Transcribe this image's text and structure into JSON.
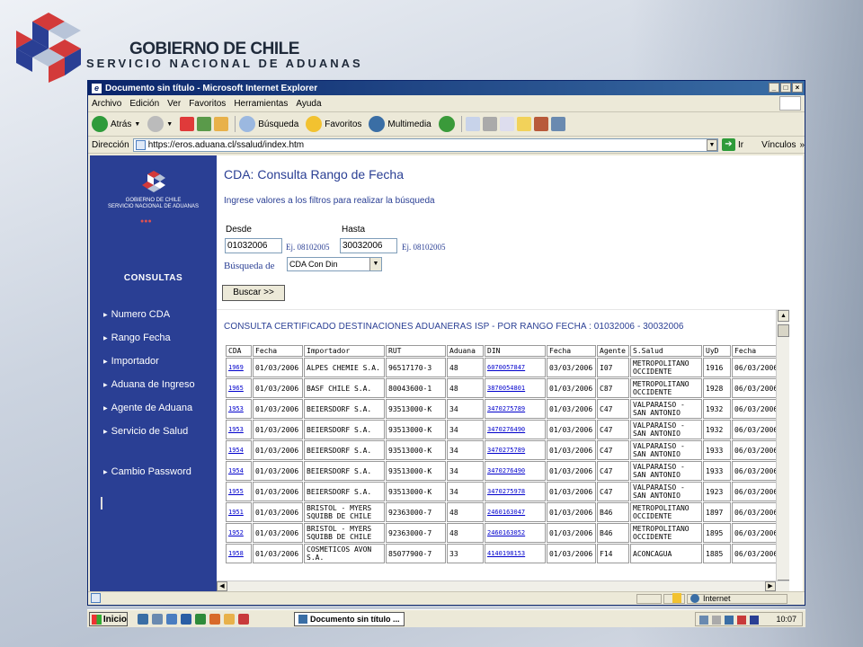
{
  "slide": {
    "header_title": "GOBIERNO DE CHILE",
    "header_subtitle": "SERVICIO NACIONAL DE ADUANAS"
  },
  "browser": {
    "title": "Documento sin título - Microsoft Internet Explorer",
    "menu": [
      "Archivo",
      "Edición",
      "Ver",
      "Favoritos",
      "Herramientas",
      "Ayuda"
    ],
    "toolbar": {
      "back": "Atrás",
      "search": "Búsqueda",
      "favorites": "Favoritos",
      "multimedia": "Multimedia"
    },
    "address_label": "Dirección",
    "url": "https://eros.aduana.cl/ssalud/index.htm",
    "go_label": "Ir",
    "links_label": "Vínculos",
    "status_zone": "Internet"
  },
  "sidebar": {
    "brand_line1": "GOBIERNO DE CHILE",
    "brand_line2": "SERVICIO NACIONAL DE ADUANAS",
    "section": "CONSULTAS",
    "items": [
      "Numero CDA",
      "Rango Fecha",
      "Importador",
      "Aduana de Ingreso",
      "Agente de Aduana",
      "Servicio de Salud",
      "Cambio Password"
    ]
  },
  "page": {
    "title": "CDA: Consulta Rango de Fecha",
    "intro": "Ingrese valores a los filtros para realizar la búsqueda",
    "desde_label": "Desde",
    "hasta_label": "Hasta",
    "desde_value": "01032006",
    "hasta_value": "30032006",
    "example_hint": "Ej. 08102005",
    "busqueda_label": "Búsqueda de",
    "busqueda_value": "CDA Con Din",
    "search_button": "Buscar >>",
    "result_title": "CONSULTA CERTIFICADO DESTINACIONES ADUANERAS ISP - POR RANGO FECHA : 01032006 - 30032006"
  },
  "table": {
    "headers": [
      "CDA",
      "Fecha",
      "Importador",
      "RUT",
      "Aduana",
      "DIN",
      "Fecha",
      "Agente",
      "S.Salud",
      "UyD",
      "Fecha"
    ],
    "rows": [
      [
        "1969",
        "01/03/2006",
        "ALPES CHEMIE S.A.",
        "96517170-3",
        "48",
        "6070057847",
        "03/03/2006",
        "I07",
        "METROPOLITANO OCCIDENTE",
        "1916",
        "06/03/2006"
      ],
      [
        "1965",
        "01/03/2006",
        "BASF CHILE S.A.",
        "80043600-1",
        "48",
        "3870054801",
        "01/03/2006",
        "C87",
        "METROPOLITANO OCCIDENTE",
        "1928",
        "06/03/2006"
      ],
      [
        "1953",
        "01/03/2006",
        "BEIERSDORF S.A.",
        "93513000-K",
        "34",
        "3470275789",
        "01/03/2006",
        "C47",
        "VALPARAISO - SAN ANTONIO",
        "1932",
        "06/03/2006"
      ],
      [
        "1953",
        "01/03/2006",
        "BEIERSDORF S.A.",
        "93513000-K",
        "34",
        "3470276490",
        "01/03/2006",
        "C47",
        "VALPARAISO - SAN ANTONIO",
        "1932",
        "06/03/2006"
      ],
      [
        "1954",
        "01/03/2006",
        "BEIERSDORF S.A.",
        "93513000-K",
        "34",
        "3470275789",
        "01/03/2006",
        "C47",
        "VALPARAISO - SAN ANTONIO",
        "1933",
        "06/03/2006"
      ],
      [
        "1954",
        "01/03/2006",
        "BEIERSDORF S.A.",
        "93513000-K",
        "34",
        "3470276490",
        "01/03/2006",
        "C47",
        "VALPARAISO - SAN ANTONIO",
        "1933",
        "06/03/2006"
      ],
      [
        "1955",
        "01/03/2006",
        "BEIERSDORF S.A.",
        "93513000-K",
        "34",
        "3470275978",
        "01/03/2006",
        "C47",
        "VALPARAISO - SAN ANTONIO",
        "1923",
        "06/03/2006"
      ],
      [
        "1951",
        "01/03/2006",
        "BRISTOL - MYERS SQUIBB DE CHILE",
        "92363000-7",
        "48",
        "2460163047",
        "01/03/2006",
        "B46",
        "METROPOLITANO OCCIDENTE",
        "1897",
        "06/03/2006"
      ],
      [
        "1952",
        "01/03/2006",
        "BRISTOL - MYERS SQUIBB DE CHILE",
        "92363000-7",
        "48",
        "2460163052",
        "01/03/2006",
        "B46",
        "METROPOLITANO OCCIDENTE",
        "1895",
        "06/03/2006"
      ],
      [
        "1958",
        "01/03/2006",
        "COSMETICOS AVON S.A.",
        "85077900-7",
        "33",
        "4140198153",
        "01/03/2006",
        "F14",
        "ACONCAGUA",
        "1885",
        "06/03/2006"
      ]
    ]
  },
  "taskbar": {
    "start": "Inicio",
    "task": "Documento sin título ...",
    "clock": "10:07"
  }
}
